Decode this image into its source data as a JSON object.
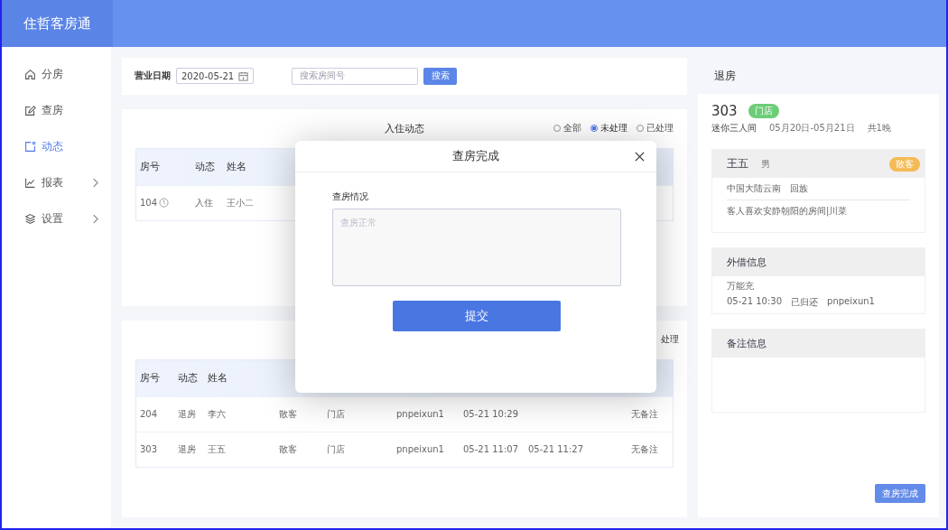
{
  "app": {
    "logo": "住哲客房通"
  },
  "sidebar": {
    "items": [
      {
        "label": "分房",
        "selected": false,
        "expandable": false
      },
      {
        "label": "查房",
        "selected": false,
        "expandable": false
      },
      {
        "label": "动态",
        "selected": true,
        "expandable": false
      },
      {
        "label": "报表",
        "selected": false,
        "expandable": true
      },
      {
        "label": "设置",
        "selected": false,
        "expandable": true
      }
    ]
  },
  "filter": {
    "date_label": "营业日期",
    "date_value": "2020-05-21",
    "search_placeholder": "搜索房间号",
    "search_button": "搜索"
  },
  "checkin_card": {
    "title": "入住动态",
    "options": [
      {
        "label": "全部",
        "selected": false
      },
      {
        "label": "未处理",
        "selected": true
      },
      {
        "label": "已处理",
        "selected": false
      }
    ],
    "table": {
      "columns": [
        "房号",
        "动态",
        "姓名"
      ],
      "rows": [
        {
          "cells": [
            "104",
            "入住",
            "王小二"
          ],
          "clock": true
        }
      ]
    }
  },
  "checkout_card": {
    "option_fragment": "处理",
    "table": {
      "columns": [
        "房号",
        "动态",
        "姓名"
      ],
      "rows": [
        {
          "cells": [
            "204",
            "退房",
            "李六",
            "散客",
            "门店",
            "pnpeixun1",
            "05-21 10:29",
            "",
            "无备注"
          ]
        },
        {
          "cells": [
            "303",
            "退房",
            "王五",
            "散客",
            "门店",
            "pnpeixun1",
            "05-21 11:07",
            "05-21 11:27",
            "无备注"
          ]
        }
      ]
    }
  },
  "detail": {
    "title": "退房",
    "room_number": "303",
    "source_tag": "门店",
    "room_type": "迷你三人间",
    "dates": "05月20日-05月21日",
    "nights": "共1晚",
    "guest": {
      "name": "王五",
      "gender": "男",
      "type_tag": "散客",
      "origin": "中国大陆云南",
      "ethnicity": "回族",
      "preference": "客人喜欢安静朝阳的房间|川菜"
    },
    "borrow": {
      "title": "外借信息",
      "item": "万能充",
      "time": "05-21 10:30",
      "status": "已归还",
      "operator": "pnpeixun1"
    },
    "remarks": {
      "title": "备注信息"
    },
    "button": "查房完成"
  },
  "modal": {
    "title": "查房完成",
    "field_label": "查房情况",
    "placeholder": "查房正常",
    "submit": "提交"
  }
}
